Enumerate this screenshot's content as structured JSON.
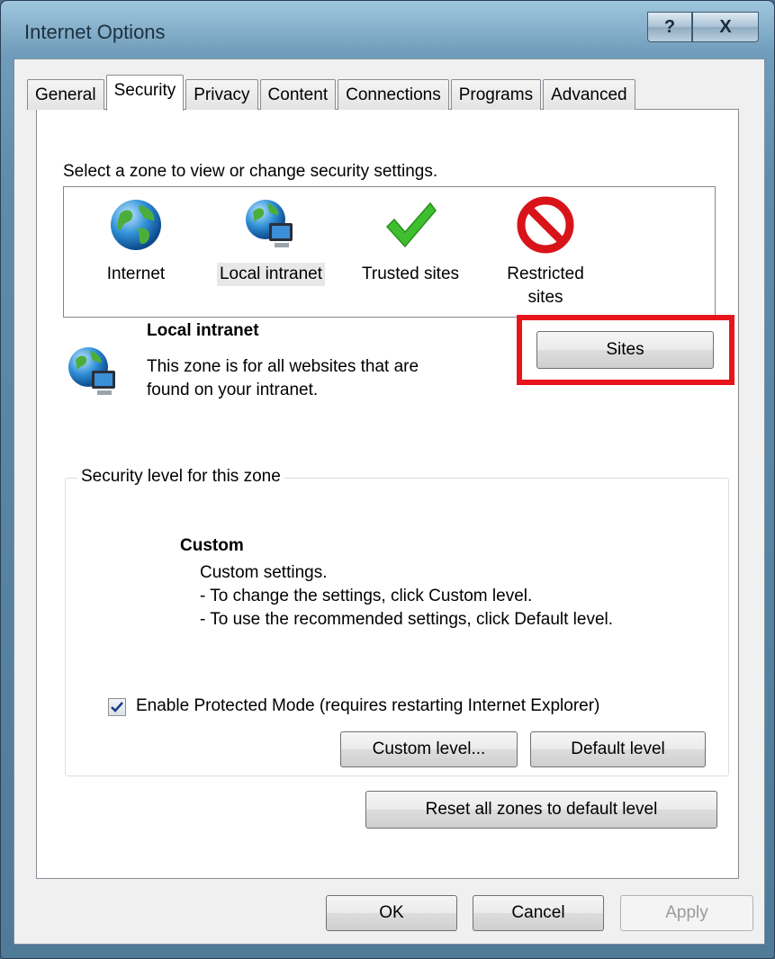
{
  "window": {
    "title": "Internet Options",
    "help_glyph": "?",
    "close_glyph": "X"
  },
  "tabs": [
    {
      "label": "General"
    },
    {
      "label": "Security",
      "active": true
    },
    {
      "label": "Privacy"
    },
    {
      "label": "Content"
    },
    {
      "label": "Connections"
    },
    {
      "label": "Programs"
    },
    {
      "label": "Advanced"
    }
  ],
  "security": {
    "zone_prompt": "Select a zone to view or change security settings.",
    "zones": [
      {
        "label": "Internet",
        "icon": "globe-icon"
      },
      {
        "label": "Local intranet",
        "icon": "globe-computer-icon",
        "selected": true
      },
      {
        "label": "Trusted sites",
        "icon": "checkmark-icon"
      },
      {
        "label": "Restricted sites",
        "line1": "Restricted",
        "line2": "sites",
        "icon": "prohibited-icon"
      }
    ],
    "selected_zone": {
      "name": "Local intranet",
      "description_line1": "This zone is for all websites that are",
      "description_line2": "found on your intranet.",
      "icon": "globe-computer-icon"
    },
    "sites_button": "Sites",
    "highlight_color": "#e8141c",
    "level_group": {
      "legend": "Security level for this zone",
      "level_name": "Custom",
      "line1": "Custom settings.",
      "line2": "- To change the settings, click Custom level.",
      "line3": "- To use the recommended settings, click Default level."
    },
    "protected_mode": {
      "label": "Enable Protected Mode (requires restarting Internet Explorer)",
      "checked": true
    },
    "custom_level_button": "Custom level...",
    "default_level_button": "Default level",
    "reset_button": "Reset all zones to default level"
  },
  "footer": {
    "ok": "OK",
    "cancel": "Cancel",
    "apply": "Apply",
    "apply_disabled": true
  }
}
